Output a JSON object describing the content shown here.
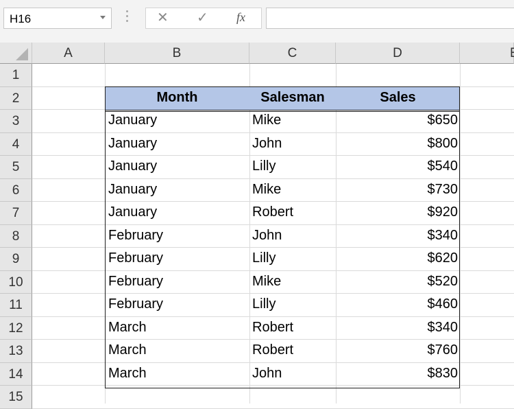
{
  "namebox": {
    "value": "H16",
    "arrow_icon": "chevron-down-icon"
  },
  "formula_bar": {
    "cancel_icon": "✕",
    "enter_icon": "✓",
    "fx_label": "fx",
    "formula_value": ""
  },
  "columns": [
    "A",
    "B",
    "C",
    "D",
    "E"
  ],
  "rows": [
    "1",
    "2",
    "3",
    "4",
    "5",
    "6",
    "7",
    "8",
    "9",
    "10",
    "11",
    "12",
    "13",
    "14",
    "15"
  ],
  "table": {
    "headers": [
      "Month",
      "Salesman",
      "Sales"
    ],
    "header_fill": "#b4c6e7",
    "records": [
      [
        "January",
        "Mike",
        "$650"
      ],
      [
        "January",
        "John",
        "$800"
      ],
      [
        "January",
        "Lilly",
        "$540"
      ],
      [
        "January",
        "Mike",
        "$730"
      ],
      [
        "January",
        "Robert",
        "$920"
      ],
      [
        "February",
        "John",
        "$340"
      ],
      [
        "February",
        "Lilly",
        "$620"
      ],
      [
        "February",
        "Mike",
        "$520"
      ],
      [
        "February",
        "Lilly",
        "$460"
      ],
      [
        "March",
        "Robert",
        "$340"
      ],
      [
        "March",
        "Robert",
        "$760"
      ],
      [
        "March",
        "John",
        "$830"
      ]
    ]
  }
}
